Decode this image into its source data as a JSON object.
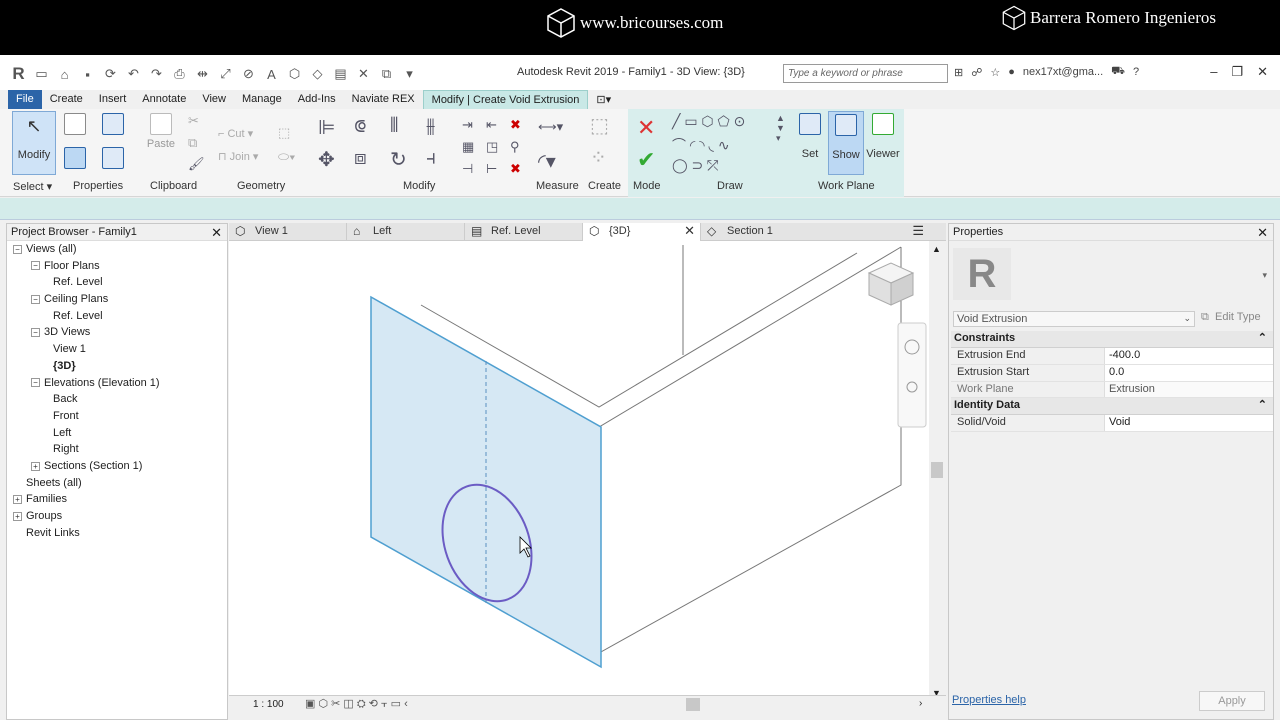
{
  "banner": {
    "left_text": "www.bricourses.com",
    "right_text": "Barrera Romero Ingenieros"
  },
  "titlebar": {
    "title": "Autodesk Revit 2019 - Family1 - 3D View: {3D}",
    "search_placeholder": "Type a keyword or phrase",
    "user": "nex17xt@gma..."
  },
  "tabs": [
    {
      "label": "File"
    },
    {
      "label": "Create"
    },
    {
      "label": "Insert"
    },
    {
      "label": "Annotate"
    },
    {
      "label": "View"
    },
    {
      "label": "Manage"
    },
    {
      "label": "Add-Ins"
    },
    {
      "label": "Naviate REX"
    },
    {
      "label": "Modify | Create Void Extrusion"
    }
  ],
  "ribbon": {
    "modify_label": "Modify",
    "paste_label": "Paste",
    "cut_label": "Cut",
    "join_label": "Join",
    "set_label": "Set",
    "show_label": "Show",
    "viewer_label": "Viewer",
    "panels": {
      "select": "Select",
      "properties": "Properties",
      "clipboard": "Clipboard",
      "geometry": "Geometry",
      "modify": "Modify",
      "measure": "Measure",
      "create": "Create",
      "mode": "Mode",
      "draw": "Draw",
      "workplane": "Work Plane"
    }
  },
  "project_browser": {
    "title": "Project Browser - Family1",
    "items": [
      {
        "label": "Views (all)",
        "level": 0
      },
      {
        "label": "Floor Plans",
        "level": 1
      },
      {
        "label": "Ref. Level",
        "level": 2
      },
      {
        "label": "Ceiling Plans",
        "level": 1
      },
      {
        "label": "Ref. Level",
        "level": 2
      },
      {
        "label": "3D Views",
        "level": 1
      },
      {
        "label": "View 1",
        "level": 2
      },
      {
        "label": "{3D}",
        "level": 2
      },
      {
        "label": "Elevations (Elevation 1)",
        "level": 1
      },
      {
        "label": "Back",
        "level": 2
      },
      {
        "label": "Front",
        "level": 2
      },
      {
        "label": "Left",
        "level": 2
      },
      {
        "label": "Right",
        "level": 2
      },
      {
        "label": "Sections (Section 1)",
        "level": 1
      },
      {
        "label": "Sheets (all)",
        "level": 0
      },
      {
        "label": "Families",
        "level": 0
      },
      {
        "label": "Groups",
        "level": 0
      },
      {
        "label": "Revit Links",
        "level": 0
      }
    ]
  },
  "view_tabs": [
    {
      "label": "View 1"
    },
    {
      "label": "Left"
    },
    {
      "label": "Ref. Level"
    },
    {
      "label": "{3D}"
    },
    {
      "label": "Section 1"
    }
  ],
  "view_status": {
    "scale": "1 : 100"
  },
  "properties": {
    "title": "Properties",
    "type_name": "Void Extrusion",
    "edit_type": "Edit Type",
    "groups": [
      {
        "name": "Constraints",
        "rows": [
          {
            "key": "Extrusion End",
            "value": "-400.0"
          },
          {
            "key": "Extrusion Start",
            "value": "0.0"
          },
          {
            "key": "Work Plane",
            "value": "Extrusion"
          }
        ]
      },
      {
        "name": "Identity Data",
        "rows": [
          {
            "key": "Solid/Void",
            "value": "Void"
          }
        ]
      }
    ],
    "help": "Properties help",
    "apply": "Apply"
  }
}
